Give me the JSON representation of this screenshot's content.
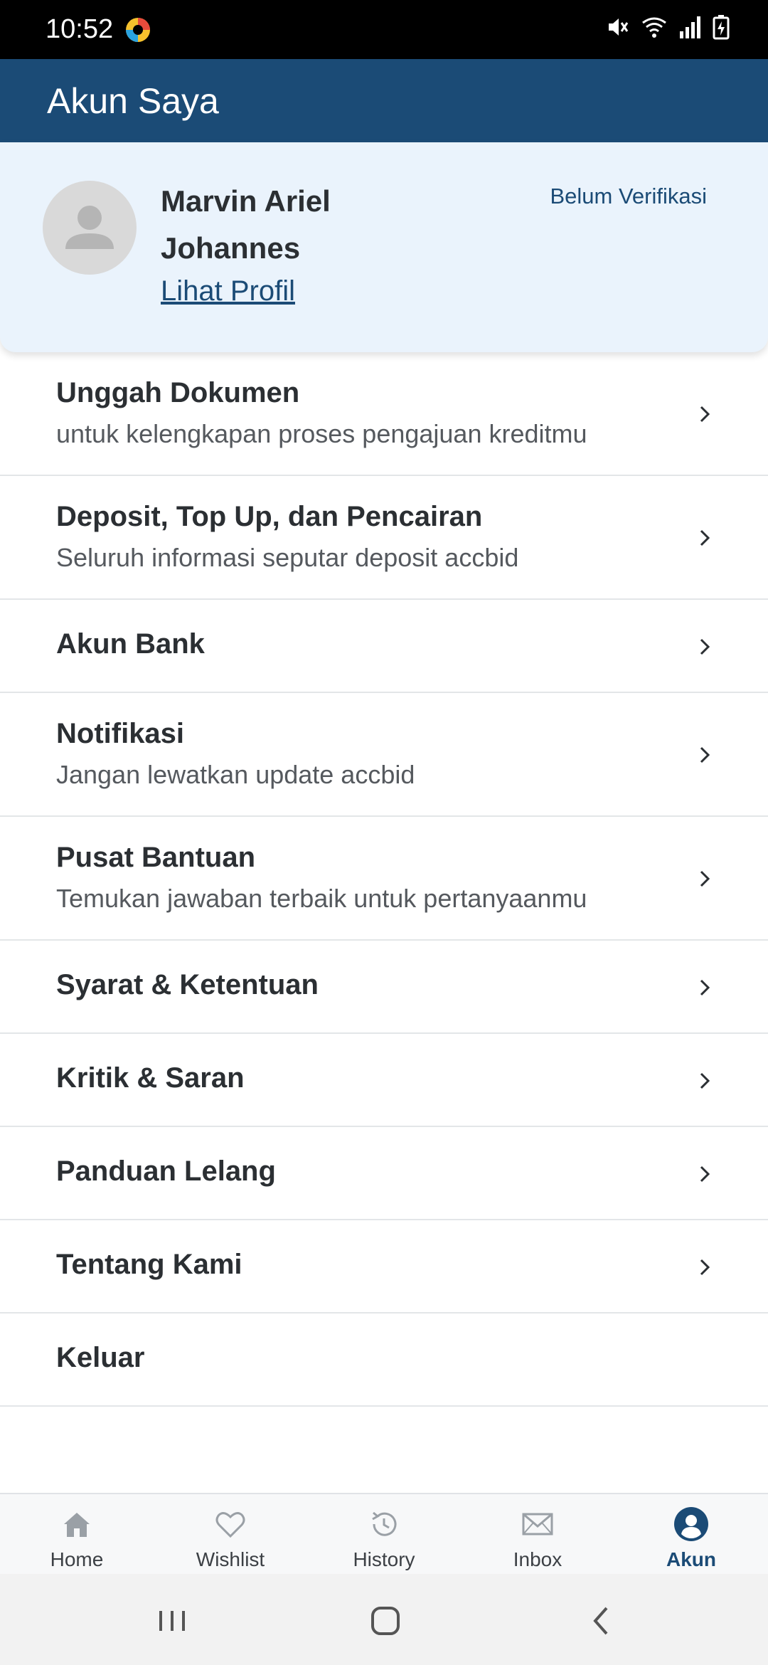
{
  "status_bar": {
    "time": "10:52",
    "icons": [
      "app-indicator-icon",
      "mute-icon",
      "wifi-icon",
      "signal-icon",
      "battery-icon"
    ]
  },
  "app_bar": {
    "title": "Akun Saya"
  },
  "profile": {
    "name": "Marvin Ariel Johannes",
    "view_profile": "Lihat Profil",
    "verification_status": "Belum Verifikasi"
  },
  "menu": [
    {
      "title": "Unggah Dokumen",
      "subtitle": "untuk kelengkapan proses pengajuan kreditmu"
    },
    {
      "title": "Deposit, Top Up, dan Pencairan",
      "subtitle": "Seluruh informasi seputar deposit accbid"
    },
    {
      "title": "Akun Bank"
    },
    {
      "title": "Notifikasi",
      "subtitle": "Jangan lewatkan update accbid"
    },
    {
      "title": "Pusat Bantuan",
      "subtitle": "Temukan jawaban terbaik untuk pertanyaanmu"
    },
    {
      "title": "Syarat & Ketentuan"
    },
    {
      "title": "Kritik & Saran"
    },
    {
      "title": "Panduan Lelang"
    },
    {
      "title": "Tentang Kami"
    },
    {
      "title": "Keluar"
    }
  ],
  "bottom_nav": [
    {
      "label": "Home",
      "icon": "home-icon"
    },
    {
      "label": "Wishlist",
      "icon": "heart-icon"
    },
    {
      "label": "History",
      "icon": "history-icon"
    },
    {
      "label": "Inbox",
      "icon": "mail-icon"
    },
    {
      "label": "Akun",
      "icon": "account-icon",
      "active": true
    }
  ],
  "colors": {
    "primary": "#1b4b76",
    "profile_card_bg": "#eaf3fc",
    "status_bar_bg": "#000000"
  }
}
